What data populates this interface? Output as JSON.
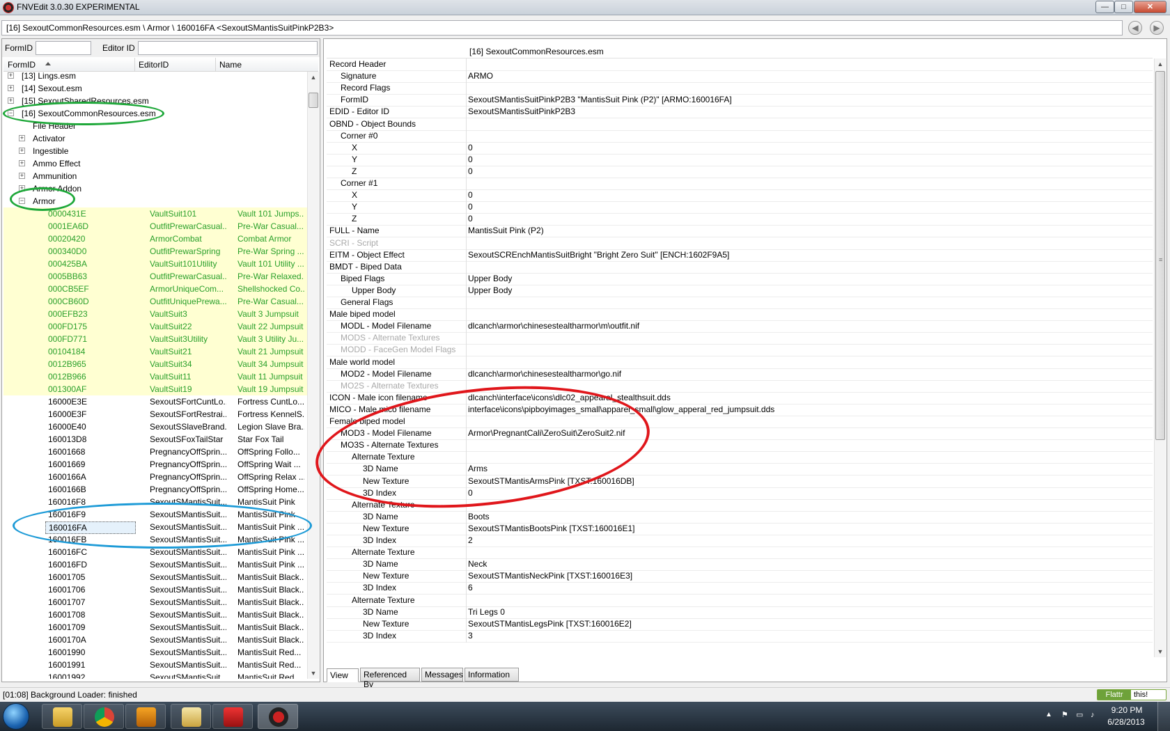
{
  "window": {
    "title": "FNVEdit 3.0.30 EXPERIMENTAL",
    "minimize": "—",
    "maximize": "□",
    "close": "✕"
  },
  "path": "[16] SexoutCommonResources.esm \\ Armor \\ 160016FA <SexoutSMantisSuitPinkP2B3>",
  "nav": {
    "back": "◀",
    "forward": "▶"
  },
  "filter": {
    "formid_label": "FormID",
    "editorid_label": "Editor ID",
    "formid_value": "",
    "editorid_value": ""
  },
  "tree": {
    "columns": [
      "FormID",
      "EditorID",
      "Name"
    ],
    "top_nodes": [
      {
        "label": "[13] Lings.esm",
        "expander": "+"
      },
      {
        "label": "[14] Sexout.esm",
        "expander": "+"
      },
      {
        "label": "[15] SexoutSharedResources.esm",
        "expander": "+"
      },
      {
        "label": "[16] SexoutCommonResources.esm",
        "expander": "−"
      },
      {
        "label": "File Header",
        "expander": ""
      },
      {
        "label": "Activator",
        "expander": "+"
      },
      {
        "label": "Ingestible",
        "expander": "+"
      },
      {
        "label": "Ammo Effect",
        "expander": "+"
      },
      {
        "label": "Ammunition",
        "expander": "+"
      },
      {
        "label": "Armor Addon",
        "expander": "+"
      },
      {
        "label": "Armor",
        "expander": "−"
      }
    ],
    "records": [
      {
        "fid": "0000431E",
        "edid": "VaultSuit101",
        "name": "Vault 101 Jumps...",
        "hl": true
      },
      {
        "fid": "0001EA6D",
        "edid": "OutfitPrewarCasual...",
        "name": "Pre-War Casual...",
        "hl": true
      },
      {
        "fid": "00020420",
        "edid": "ArmorCombat",
        "name": "Combat Armor",
        "hl": true
      },
      {
        "fid": "000340D0",
        "edid": "OutfitPrewarSpring",
        "name": "Pre-War Spring ...",
        "hl": true
      },
      {
        "fid": "000425BA",
        "edid": "VaultSuit101Utility",
        "name": "Vault 101 Utility ...",
        "hl": true
      },
      {
        "fid": "0005BB63",
        "edid": "OutfitPrewarCasual...",
        "name": "Pre-War Relaxed...",
        "hl": true
      },
      {
        "fid": "000CB5EF",
        "edid": "ArmorUniqueCom...",
        "name": "Shellshocked Co...",
        "hl": true
      },
      {
        "fid": "000CB60D",
        "edid": "OutfitUniquePrewa...",
        "name": "Pre-War Casual...",
        "hl": true
      },
      {
        "fid": "000EFB23",
        "edid": "VaultSuit3",
        "name": "Vault 3 Jumpsuit",
        "hl": true
      },
      {
        "fid": "000FD175",
        "edid": "VaultSuit22",
        "name": "Vault 22 Jumpsuit",
        "hl": true
      },
      {
        "fid": "000FD771",
        "edid": "VaultSuit3Utility",
        "name": "Vault 3 Utility Ju...",
        "hl": true
      },
      {
        "fid": "00104184",
        "edid": "VaultSuit21",
        "name": "Vault 21 Jumpsuit",
        "hl": true
      },
      {
        "fid": "0012B965",
        "edid": "VaultSuit34",
        "name": "Vault 34 Jumpsuit",
        "hl": true
      },
      {
        "fid": "0012B966",
        "edid": "VaultSuit11",
        "name": "Vault 11 Jumpsuit",
        "hl": true
      },
      {
        "fid": "001300AF",
        "edid": "VaultSuit19",
        "name": "Vault 19 Jumpsuit",
        "hl": true
      },
      {
        "fid": "16000E3E",
        "edid": "SexoutSFortCuntLo...",
        "name": "Fortress CuntLo...",
        "hl": false
      },
      {
        "fid": "16000E3F",
        "edid": "SexoutSFortRestrai...",
        "name": "Fortress KennelS...",
        "hl": false
      },
      {
        "fid": "16000E40",
        "edid": "SexoutSSlaveBrand...",
        "name": "Legion Slave Bra...",
        "hl": false
      },
      {
        "fid": "160013D8",
        "edid": "SexoutSFoxTailStar",
        "name": "Star Fox Tail",
        "hl": false
      },
      {
        "fid": "16001668",
        "edid": "PregnancyOffSprin...",
        "name": "OffSpring Follo...",
        "hl": false
      },
      {
        "fid": "16001669",
        "edid": "PregnancyOffSprin...",
        "name": "OffSpring Wait ...",
        "hl": false
      },
      {
        "fid": "1600166A",
        "edid": "PregnancyOffSprin...",
        "name": "OffSpring Relax ...",
        "hl": false
      },
      {
        "fid": "1600166B",
        "edid": "PregnancyOffSprin...",
        "name": "OffSpring Home...",
        "hl": false
      },
      {
        "fid": "160016F8",
        "edid": "SexoutSMantisSuit...",
        "name": "MantisSuit Pink",
        "hl": false
      },
      {
        "fid": "160016F9",
        "edid": "SexoutSMantisSuit...",
        "name": "MantisSuit Pink",
        "hl": false
      },
      {
        "fid": "160016FA",
        "edid": "SexoutSMantisSuit...",
        "name": "MantisSuit Pink ...",
        "hl": false,
        "sel": true
      },
      {
        "fid": "160016FB",
        "edid": "SexoutSMantisSuit...",
        "name": "MantisSuit Pink ...",
        "hl": false
      },
      {
        "fid": "160016FC",
        "edid": "SexoutSMantisSuit...",
        "name": "MantisSuit Pink ...",
        "hl": false
      },
      {
        "fid": "160016FD",
        "edid": "SexoutSMantisSuit...",
        "name": "MantisSuit Pink ...",
        "hl": false
      },
      {
        "fid": "16001705",
        "edid": "SexoutSMantisSuit...",
        "name": "MantisSuit Black...",
        "hl": false
      },
      {
        "fid": "16001706",
        "edid": "SexoutSMantisSuit...",
        "name": "MantisSuit Black...",
        "hl": false
      },
      {
        "fid": "16001707",
        "edid": "SexoutSMantisSuit...",
        "name": "MantisSuit Black...",
        "hl": false
      },
      {
        "fid": "16001708",
        "edid": "SexoutSMantisSuit...",
        "name": "MantisSuit Black...",
        "hl": false
      },
      {
        "fid": "16001709",
        "edid": "SexoutSMantisSuit...",
        "name": "MantisSuit Black...",
        "hl": false
      },
      {
        "fid": "1600170A",
        "edid": "SexoutSMantisSuit...",
        "name": "MantisSuit Black...",
        "hl": false
      },
      {
        "fid": "16001990",
        "edid": "SexoutSMantisSuit...",
        "name": "MantisSuit Red...",
        "hl": false
      },
      {
        "fid": "16001991",
        "edid": "SexoutSMantisSuit...",
        "name": "MantisSuit Red...",
        "hl": false
      },
      {
        "fid": "16001992",
        "edid": "SexoutSMantisSuit...",
        "name": "MantisSuit Red...",
        "hl": false
      }
    ]
  },
  "view": {
    "header_file": "[16] SexoutCommonResources.esm",
    "rows": [
      {
        "k": "Record Header",
        "v": "",
        "d": 0
      },
      {
        "k": "Signature",
        "v": "ARMO",
        "d": 1
      },
      {
        "k": "Record Flags",
        "v": "",
        "d": 1
      },
      {
        "k": "FormID",
        "v": "SexoutSMantisSuitPinkP2B3 \"MantisSuit Pink (P2)\" [ARMO:160016FA]",
        "d": 1
      },
      {
        "k": "EDID - Editor ID",
        "v": "SexoutSMantisSuitPinkP2B3",
        "d": 0
      },
      {
        "k": "OBND - Object Bounds",
        "v": "",
        "d": 0
      },
      {
        "k": "Corner #0",
        "v": "",
        "d": 1
      },
      {
        "k": "X",
        "v": "0",
        "d": 2
      },
      {
        "k": "Y",
        "v": "0",
        "d": 2
      },
      {
        "k": "Z",
        "v": "0",
        "d": 2
      },
      {
        "k": "Corner #1",
        "v": "",
        "d": 1
      },
      {
        "k": "X",
        "v": "0",
        "d": 2
      },
      {
        "k": "Y",
        "v": "0",
        "d": 2
      },
      {
        "k": "Z",
        "v": "0",
        "d": 2
      },
      {
        "k": "FULL - Name",
        "v": "MantisSuit Pink (P2)",
        "d": 0
      },
      {
        "k": "SCRI - Script",
        "v": "",
        "d": 0,
        "dim": true
      },
      {
        "k": "EITM - Object Effect",
        "v": "SexoutSCREnchMantisSuitBright \"Bright Zero Suit\" [ENCH:1602F9A5]",
        "d": 0
      },
      {
        "k": "BMDT - Biped Data",
        "v": "",
        "d": 0
      },
      {
        "k": "Biped Flags",
        "v": "Upper Body",
        "d": 1
      },
      {
        "k": "Upper Body",
        "v": "Upper Body",
        "d": 2
      },
      {
        "k": "General Flags",
        "v": "",
        "d": 1
      },
      {
        "k": "Male biped model",
        "v": "",
        "d": 0
      },
      {
        "k": "MODL - Model Filename",
        "v": "dlcanch\\armor\\chinesestealtharmor\\m\\outfit.nif",
        "d": 1
      },
      {
        "k": "MODS - Alternate Textures",
        "v": "",
        "d": 1,
        "dim": true
      },
      {
        "k": "MODD - FaceGen Model Flags",
        "v": "",
        "d": 1,
        "dim": true
      },
      {
        "k": "Male world model",
        "v": "",
        "d": 0
      },
      {
        "k": "MOD2 - Model Filename",
        "v": "dlcanch\\armor\\chinesestealtharmor\\go.nif",
        "d": 1
      },
      {
        "k": "MO2S - Alternate Textures",
        "v": "",
        "d": 1,
        "dim": true
      },
      {
        "k": "ICON - Male icon filename",
        "v": "dlcanch\\interface\\icons\\dlc02_appearal_stealthsuit.dds",
        "d": 0
      },
      {
        "k": "MICO - Male mico filename",
        "v": "interface\\icons\\pipboyimages_small\\apparel_small\\glow_apperal_red_jumpsuit.dds",
        "d": 0
      },
      {
        "k": "Female biped model",
        "v": "",
        "d": 0
      },
      {
        "k": "MOD3 - Model Filename",
        "v": "Armor\\PregnantCali\\ZeroSuit\\ZeroSuit2.nif",
        "d": 1
      },
      {
        "k": "MO3S - Alternate Textures",
        "v": "",
        "d": 1
      },
      {
        "k": "Alternate Texture",
        "v": "",
        "d": 2
      },
      {
        "k": "3D Name",
        "v": "Arms",
        "d": 3
      },
      {
        "k": "New Texture",
        "v": "SexoutSTMantisArmsPink [TXST:160016DB]",
        "d": 3
      },
      {
        "k": "3D Index",
        "v": "0",
        "d": 3
      },
      {
        "k": "Alternate Texture",
        "v": "",
        "d": 2
      },
      {
        "k": "3D Name",
        "v": "Boots",
        "d": 3
      },
      {
        "k": "New Texture",
        "v": "SexoutSTMantisBootsPink [TXST:160016E1]",
        "d": 3
      },
      {
        "k": "3D Index",
        "v": "2",
        "d": 3
      },
      {
        "k": "Alternate Texture",
        "v": "",
        "d": 2
      },
      {
        "k": "3D Name",
        "v": "Neck",
        "d": 3
      },
      {
        "k": "New Texture",
        "v": "SexoutSTMantisNeckPink [TXST:160016E3]",
        "d": 3
      },
      {
        "k": "3D Index",
        "v": "6",
        "d": 3
      },
      {
        "k": "Alternate Texture",
        "v": "",
        "d": 2
      },
      {
        "k": "3D Name",
        "v": "Tri Legs 0",
        "d": 3
      },
      {
        "k": "New Texture",
        "v": "SexoutSTMantisLegsPink [TXST:160016E2]",
        "d": 3
      },
      {
        "k": "3D Index",
        "v": "3",
        "d": 3
      }
    ]
  },
  "tabs": [
    "View",
    "Referenced By",
    "Messages",
    "Information"
  ],
  "status": "[01:08] Background Loader: finished",
  "flattr": {
    "left": "Flattr",
    "right": "this!"
  },
  "clock": {
    "time": "9:20 PM",
    "date": "6/28/2013"
  },
  "colors": {
    "highlight_row_bg": "#ffffd2",
    "highlight_text": "#2aa02a",
    "anno_green": "#1fa83a",
    "anno_blue": "#1e9bd7",
    "anno_red": "#e0161b"
  }
}
